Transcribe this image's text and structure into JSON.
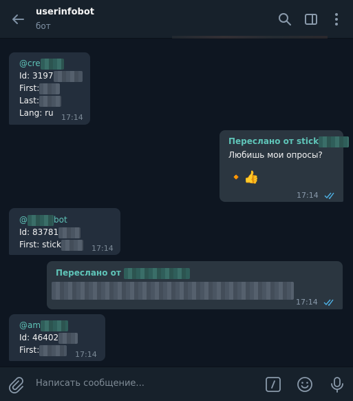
{
  "header": {
    "title": "userinfobot",
    "subtitle": "бот"
  },
  "messages": [
    {
      "username_prefix": "@cre",
      "id_prefix": "Id: 3197",
      "first_label": "First:",
      "last_label": "Last:",
      "lang": "Lang: ru",
      "time": "17:14"
    },
    {
      "forward_label": "Переслано от stick",
      "text": "Любишь мои опросы?",
      "emoji": "🔸👍",
      "time": "17:14"
    },
    {
      "username_suffix": "bot",
      "username_prefix": "@",
      "id_prefix": "Id: 83781",
      "first_label": "First: stick",
      "time": "17:14"
    },
    {
      "forward_label": "Переслано от",
      "time": "17:14"
    },
    {
      "username_prefix": "@am",
      "id_prefix": "Id: 46402",
      "first_label": "First:",
      "time": "17:14"
    }
  ],
  "composer": {
    "placeholder": "Написать сообщение..."
  },
  "colors": {
    "background": "#0e1621",
    "header": "#17212b",
    "incoming_bubble": "#232e3c",
    "outgoing_bubble": "#2b3640",
    "accent": "#5fc4b8"
  }
}
